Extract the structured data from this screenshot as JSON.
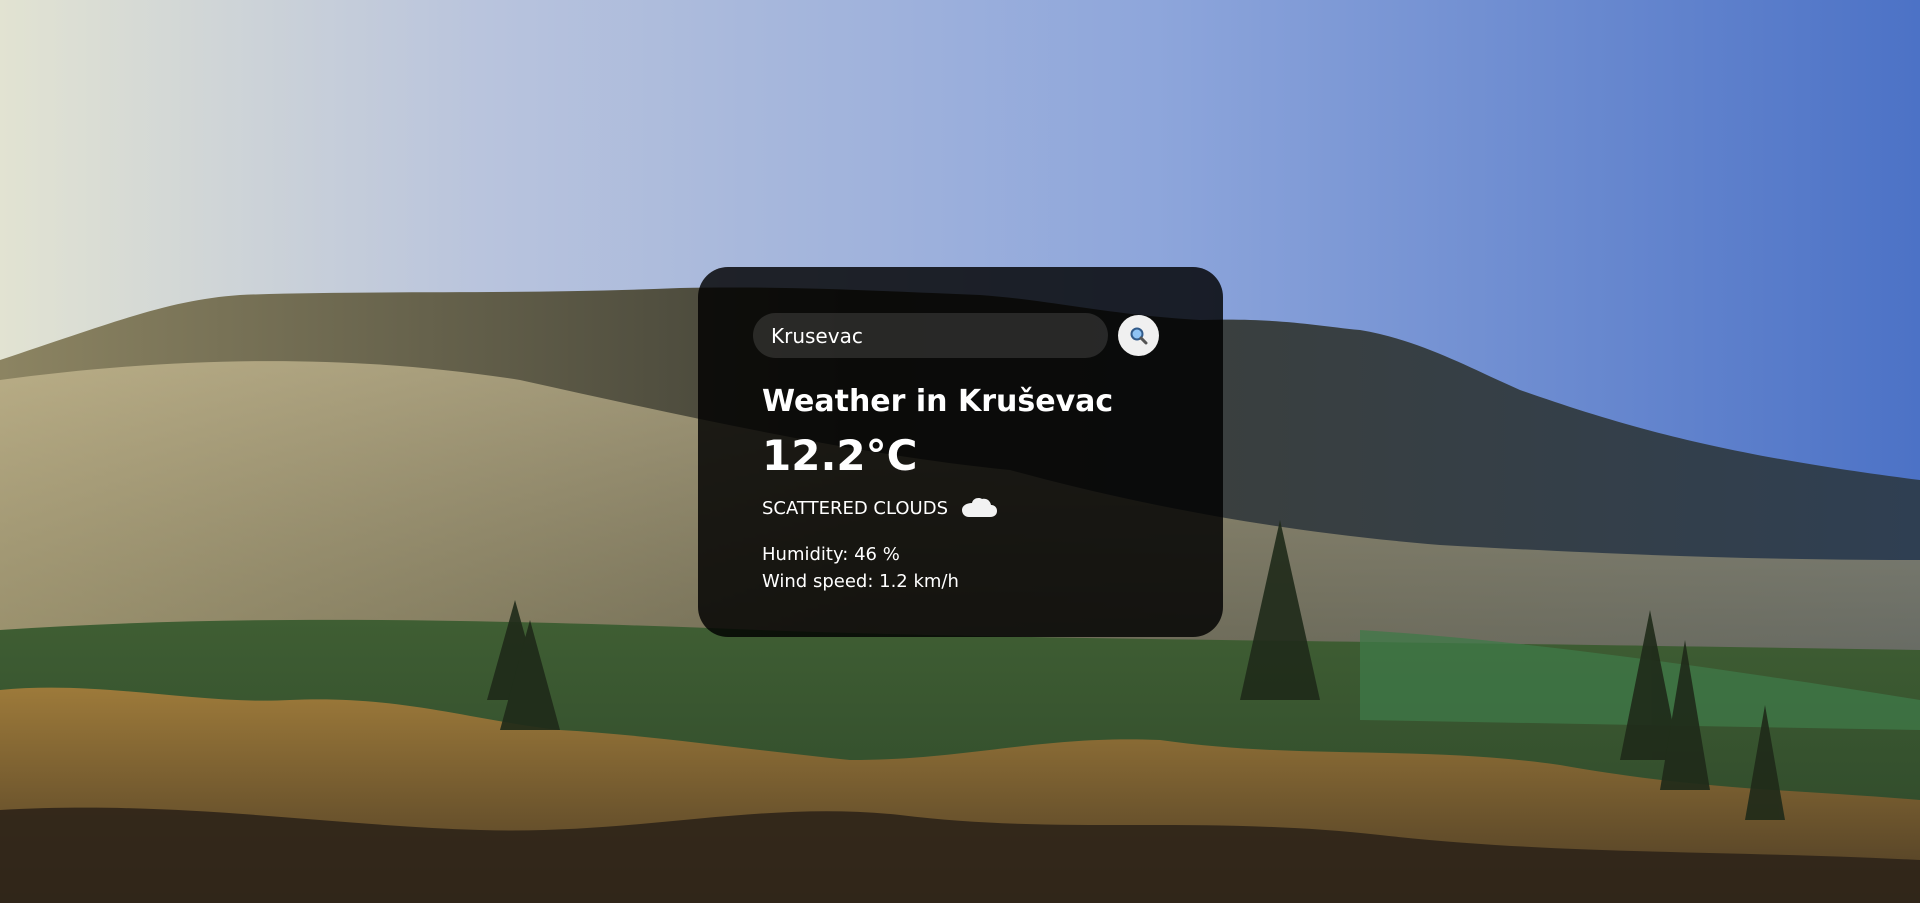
{
  "search": {
    "value": "Krusevac",
    "button_icon": "search-icon"
  },
  "weather": {
    "title": "Weather in Kruševac",
    "temperature": "12.2°C",
    "description": "SCATTERED CLOUDS",
    "condition_icon": "cloud-icon",
    "humidity": "Humidity: 46 %",
    "wind": "Wind speed: 1.2 km/h"
  },
  "colors": {
    "card_background": "#000000",
    "text": "#ffffff",
    "search_button_background": "#f0f0f0"
  }
}
